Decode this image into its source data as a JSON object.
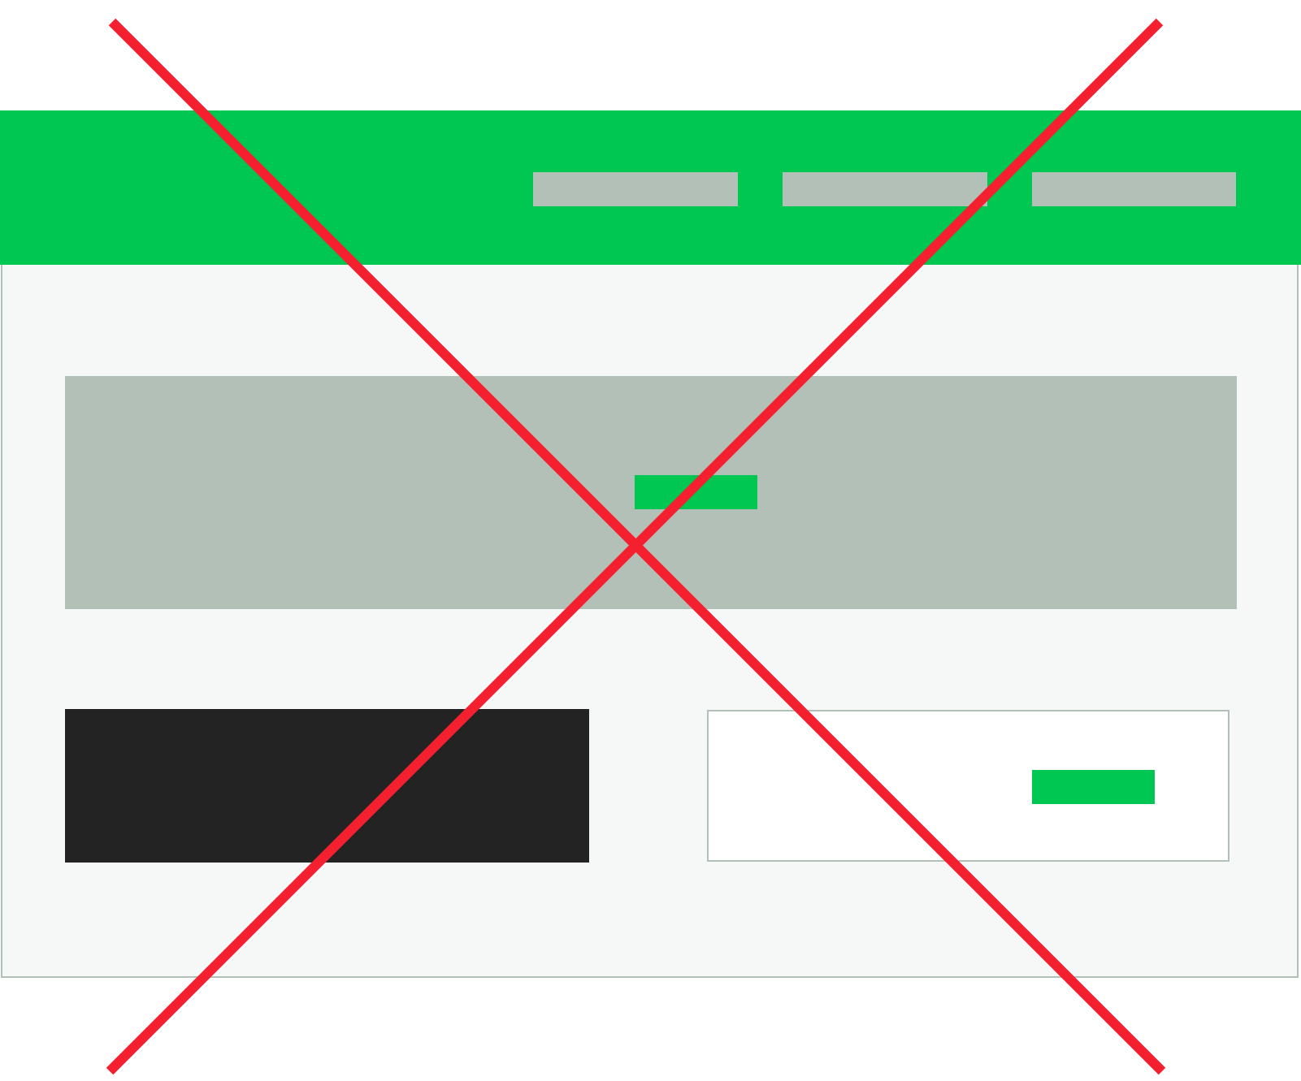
{
  "colors": {
    "header_green": "#00c652",
    "placeholder_gray": "#b3c0b8",
    "page_background": "#f6f8f7",
    "dark_block": "#232323",
    "card_white": "#ffffff",
    "cross_red": "#f5202f"
  },
  "icons": {
    "overlay": "red-x-cross-icon"
  }
}
